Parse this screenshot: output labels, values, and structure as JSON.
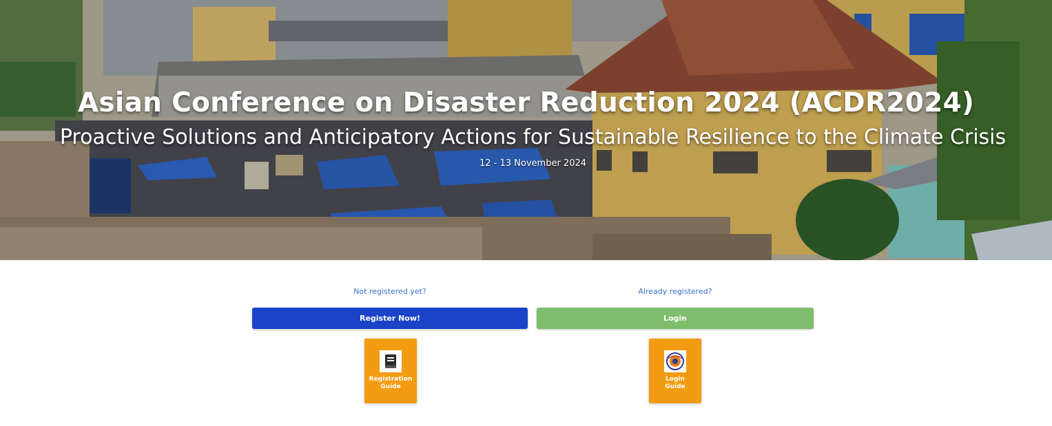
{
  "hero": {
    "title": "Asian Conference on Disaster Reduction 2024 (ACDR2024)",
    "subtitle": "Proactive Solutions and Anticipatory Actions for Sustainable Resilience to the Climate Crisis",
    "date": "12 - 13 November 2024"
  },
  "register": {
    "prompt": "Not registered yet?",
    "button_label": "Register Now!",
    "guide_line1": "Registration",
    "guide_line2": "Guide",
    "guide_icon": "book-icon"
  },
  "login": {
    "prompt": "Already registered?",
    "button_label": "Login",
    "guide_line1": "Login",
    "guide_line2": "Guide",
    "guide_icon": "emblem-icon"
  },
  "colors": {
    "register_button": "#1a43c8",
    "login_button": "#7dbd6c",
    "guide_tile": "#f39c12",
    "prompt_text": "#3a70c9"
  }
}
